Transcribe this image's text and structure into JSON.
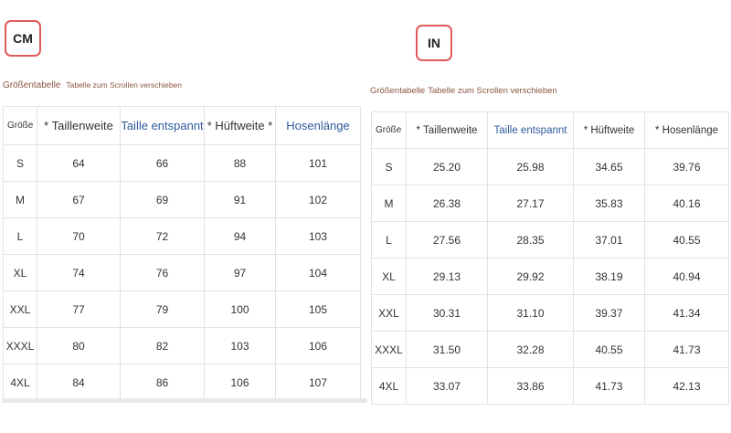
{
  "cm": {
    "badge": "CM",
    "caption_title": "Größentabelle",
    "caption_hint": "Tabelle zum Scrollen verschieben",
    "headers": [
      "Größe",
      "* Taillenweite",
      "Taille entspannt",
      "* Hüftweite *",
      "Hosenlänge"
    ],
    "rows": [
      [
        "S",
        "64",
        "66",
        "88",
        "101"
      ],
      [
        "M",
        "67",
        "69",
        "91",
        "102"
      ],
      [
        "L",
        "70",
        "72",
        "94",
        "103"
      ],
      [
        "XL",
        "74",
        "76",
        "97",
        "104"
      ],
      [
        "XXL",
        "77",
        "79",
        "100",
        "105"
      ],
      [
        "XXXL",
        "80",
        "82",
        "103",
        "106"
      ],
      [
        "4XL",
        "84",
        "86",
        "106",
        "107"
      ]
    ]
  },
  "inch": {
    "badge": "IN",
    "caption_title": "Größentabelle",
    "caption_hint": "Tabelle zum Scrollen verschieben",
    "headers": [
      "Größe",
      "* Taillenweite",
      "Taille entspannt",
      "* Hüftweite",
      "* Hosenlänge"
    ],
    "rows": [
      [
        "S",
        "25.20",
        "25.98",
        "34.65",
        "39.76"
      ],
      [
        "M",
        "26.38",
        "27.17",
        "35.83",
        "40.16"
      ],
      [
        "L",
        "27.56",
        "28.35",
        "37.01",
        "40.55"
      ],
      [
        "XL",
        "29.13",
        "29.92",
        "38.19",
        "40.94"
      ],
      [
        "XXL",
        "30.31",
        "31.10",
        "39.37",
        "41.34"
      ],
      [
        "XXXL",
        "31.50",
        "32.28",
        "40.55",
        "41.73"
      ],
      [
        "4XL",
        "33.07",
        "33.86",
        "41.73",
        "42.13"
      ]
    ]
  },
  "colors": {
    "badge_border": "#e05a5a",
    "caption": "#8a5542",
    "header_accent": "#2f5a9c",
    "grid": "#e3e3e3"
  }
}
